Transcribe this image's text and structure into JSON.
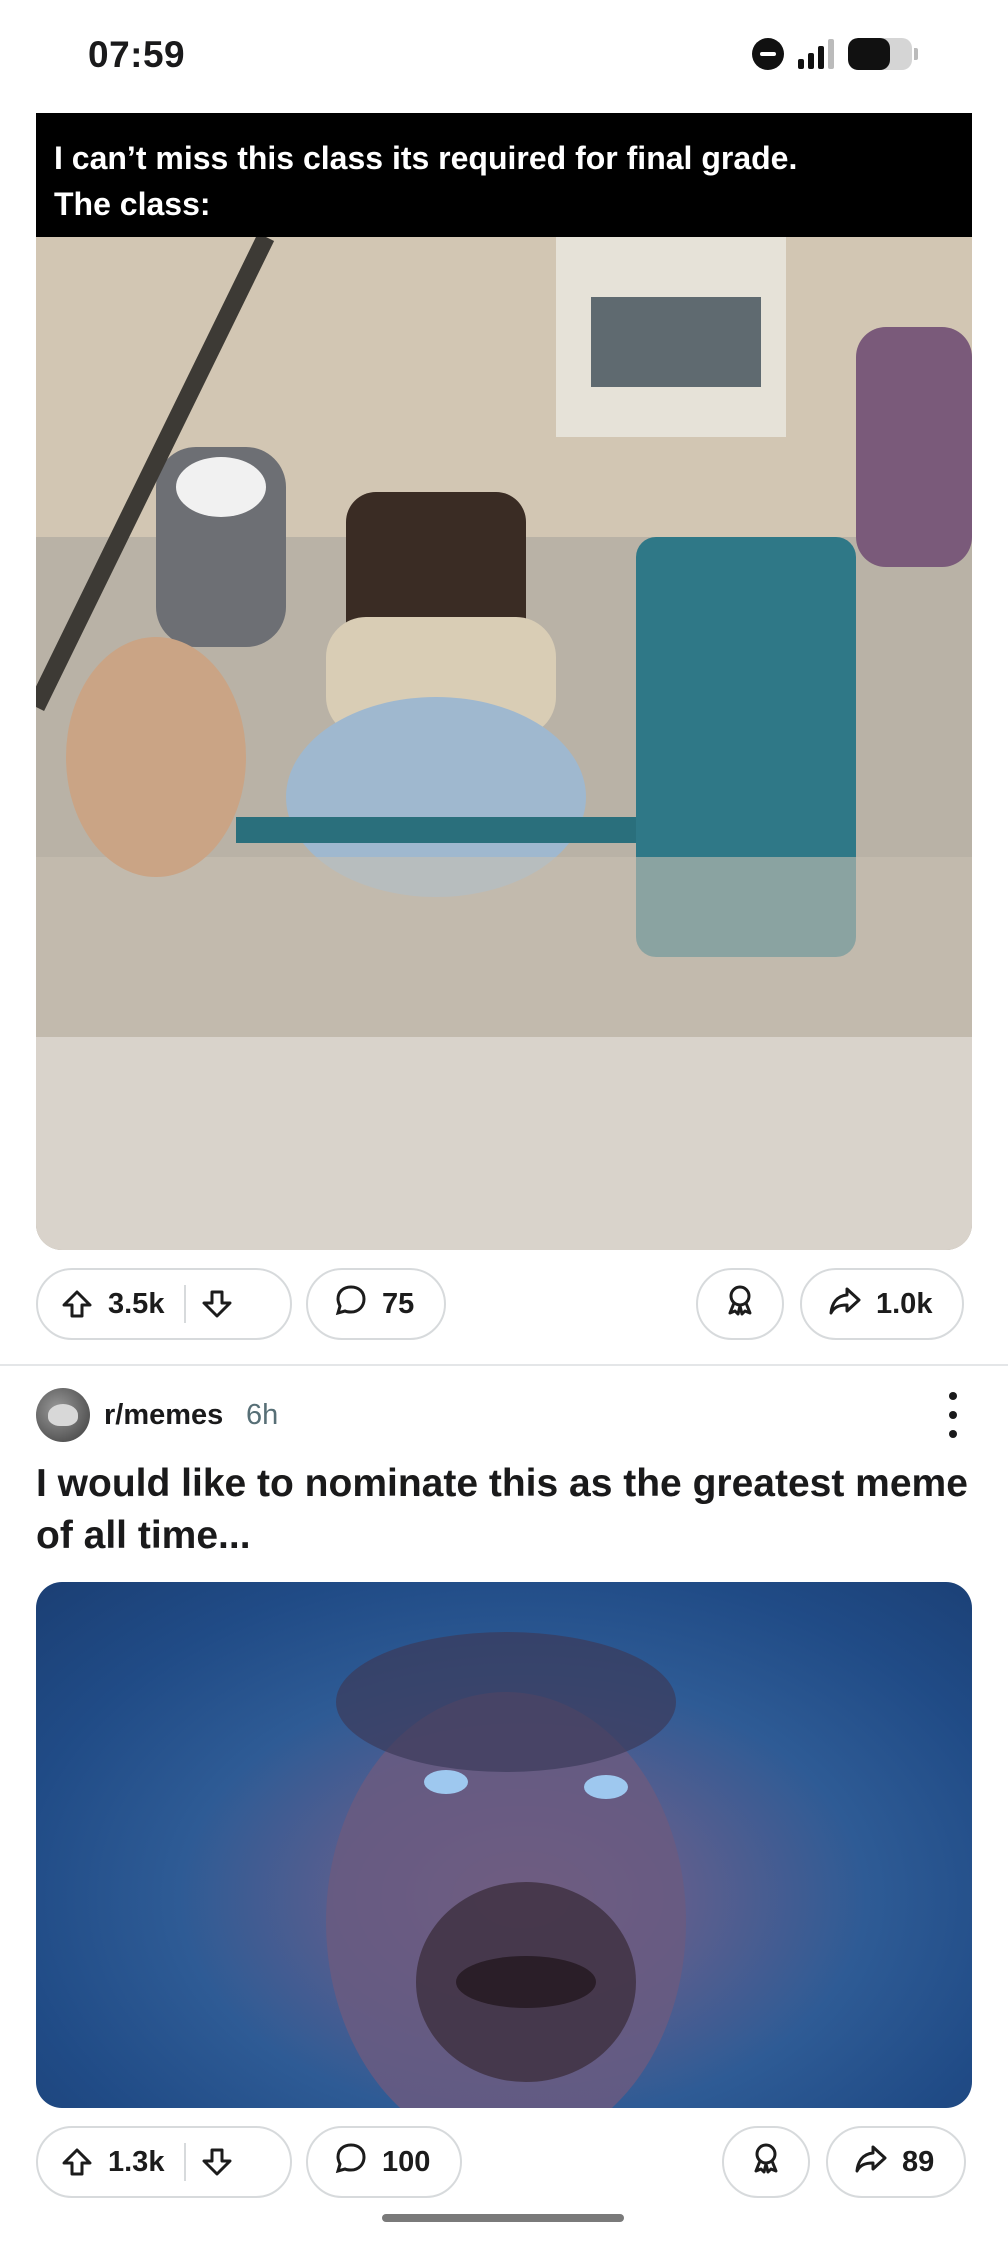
{
  "status_bar": {
    "time": "07:59",
    "battery_level": 0.65
  },
  "post1": {
    "caption_line1": "I can’t miss this class its required for final grade.",
    "caption_line2": "The class:",
    "upvotes": "3.5k",
    "comments": "75",
    "shares": "1.0k"
  },
  "post2": {
    "subreddit": "r/memes",
    "age": "6h",
    "title": "I would like to nominate this as the greatest meme of all time...",
    "upvotes": "1.3k",
    "comments": "100",
    "shares": "89"
  },
  "icons": {
    "upvote": "upvote-arrow-icon",
    "downvote": "downvote-arrow-icon",
    "comment": "speech-bubble-icon",
    "award": "award-ribbon-icon",
    "share": "share-arrow-icon",
    "more": "vertical-ellipsis-icon"
  }
}
